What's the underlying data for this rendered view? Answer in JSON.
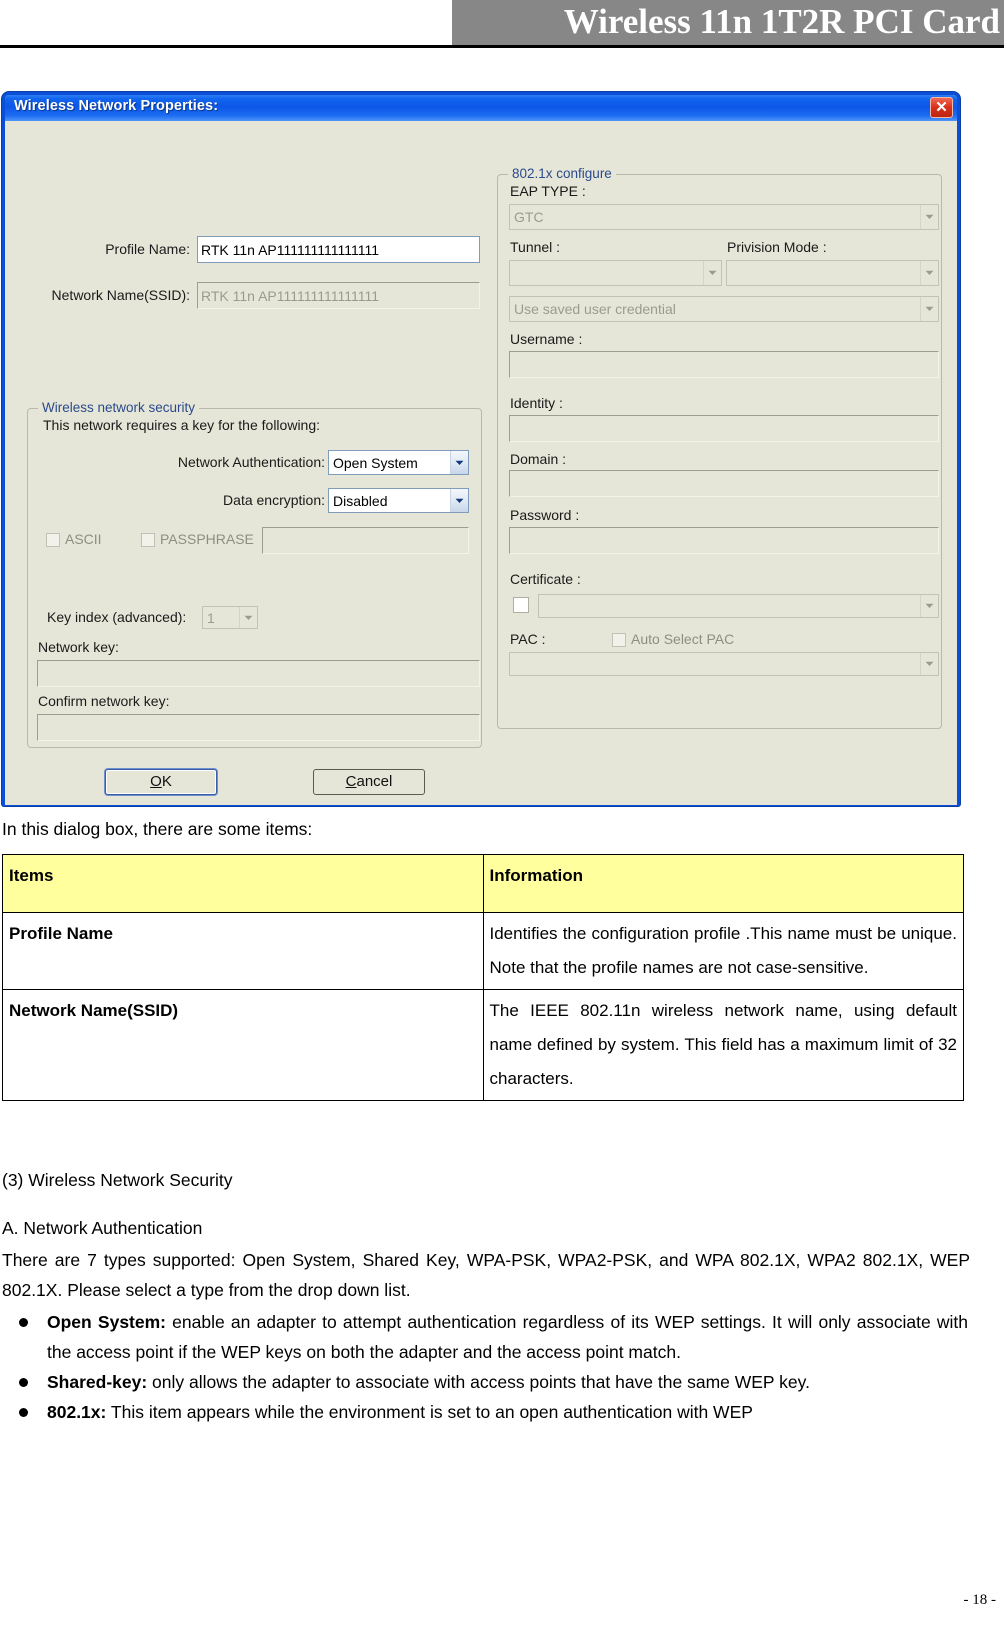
{
  "header": {
    "title": "Wireless 11n 1T2R PCI Card"
  },
  "dialog": {
    "title": "Wireless Network Properties:",
    "close_label": "✕",
    "left": {
      "profile_name_label": "Profile Name:",
      "profile_name_value": "RTK 11n AP111111111111111",
      "ssid_label": "Network Name(SSID):",
      "ssid_value": "RTK 11n AP111111111111111",
      "security_group_legend": "Wireless network security",
      "requires_key_text": "This network requires a key for the following:",
      "network_auth_label": "Network Authentication:",
      "network_auth_value": "Open System",
      "data_encryption_label": "Data encryption:",
      "data_encryption_value": "Disabled",
      "ascii_label": "ASCII",
      "passphrase_label": "PASSPHRASE",
      "passphrase_value": "",
      "key_index_label": "Key index (advanced):",
      "key_index_value": "1",
      "network_key_label": "Network key:",
      "network_key_value": "",
      "confirm_key_label": "Confirm network key:",
      "confirm_key_value": ""
    },
    "right": {
      "group_legend": "802.1x configure",
      "eap_type_label": "EAP TYPE :",
      "eap_type_value": "GTC",
      "tunnel_label": "Tunnel :",
      "tunnel_value": "",
      "privision_mode_label": "Privision Mode :",
      "privision_mode_value": "",
      "credential_value": "Use saved user credential",
      "username_label": "Username :",
      "username_value": "",
      "identity_label": "Identity :",
      "identity_value": "",
      "domain_label": "Domain :",
      "domain_value": "",
      "password_label": "Password :",
      "password_value": "",
      "certificate_label": "Certificate :",
      "certificate_value": "",
      "pac_label": "PAC :",
      "auto_select_pac_label": "Auto Select PAC",
      "pac_value": ""
    },
    "buttons": {
      "ok_label": "OK",
      "ok_accel": "O",
      "cancel_label": "Cancel",
      "cancel_accel": "C"
    }
  },
  "doc": {
    "intro": "In this dialog box, there are some items:",
    "table": {
      "headers": [
        "Items",
        "Information"
      ],
      "rows": [
        {
          "item": "Profile Name",
          "info": "Identifies the configuration profile .This name must be unique. Note that the profile names are not case-sensitive."
        },
        {
          "item": "Network Name(SSID)",
          "info": "The IEEE 802.11n wireless network name, using default name defined by system. This field has a maximum limit of 32 characters."
        }
      ]
    },
    "section_heading": "(3) Wireless Network Security",
    "subsection_heading": "A. Network Authentication",
    "paragraph": "There are 7 types supported: Open System, Shared Key, WPA-PSK, WPA2-PSK, and WPA 802.1X, WPA2 802.1X, WEP 802.1X. Please select a type from the drop down list.",
    "bullets": [
      {
        "term": "Open System:",
        "text": " enable an adapter to attempt authentication regardless of its WEP settings. It will only associate with the access point if the WEP keys on both the adapter and the access point match."
      },
      {
        "term": "Shared-key:",
        "text": " only allows the adapter to associate with access points that have the same WEP key."
      },
      {
        "term": "802.1x:",
        "text": " This item appears while the environment is set to an open authentication with WEP"
      }
    ],
    "page_number": "- 18 -"
  }
}
